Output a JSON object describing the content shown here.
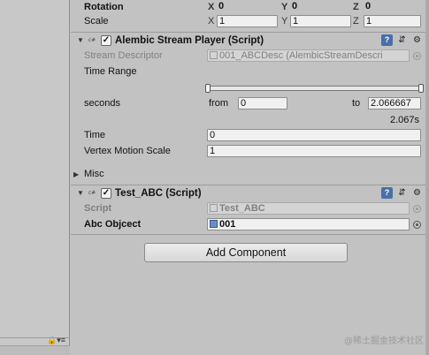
{
  "transform": {
    "rotation": {
      "label": "Rotation",
      "x": "0",
      "y": "0",
      "z": "0"
    },
    "scale": {
      "label": "Scale",
      "x": "1",
      "y": "1",
      "z": "1"
    },
    "axes": {
      "x": "X",
      "y": "Y",
      "z": "Z"
    }
  },
  "alembic": {
    "title": "Alembic Stream Player (Script)",
    "enabled": true,
    "stream_descriptor_label": "Stream Descriptor",
    "stream_descriptor_value": "001_ABCDesc (AlembicStreamDescri",
    "time_range_label": "Time Range",
    "seconds_label": "seconds",
    "from_label": "from",
    "from_value": "0",
    "to_label": "to",
    "to_value": "2.066667",
    "duration": "2.067s",
    "time_label": "Time",
    "time_value": "0",
    "vertex_motion_scale_label": "Vertex Motion Scale",
    "vertex_motion_scale_value": "1",
    "misc_label": "Misc"
  },
  "test_abc": {
    "title": "Test_ABC (Script)",
    "enabled": true,
    "script_label": "Script",
    "script_value": "Test_ABC",
    "abc_object_label": "Abc Objcect",
    "abc_object_value": "001"
  },
  "add_component_label": "Add Component",
  "watermark": "@稀土掘金技术社区",
  "icons": {
    "foldout": "triangle-down-icon",
    "script": "script-icon",
    "help": "help-icon",
    "presets": "presets-icon",
    "gear": "gear-icon",
    "lock": "lock-icon",
    "object_picker": "object-picker-icon"
  }
}
